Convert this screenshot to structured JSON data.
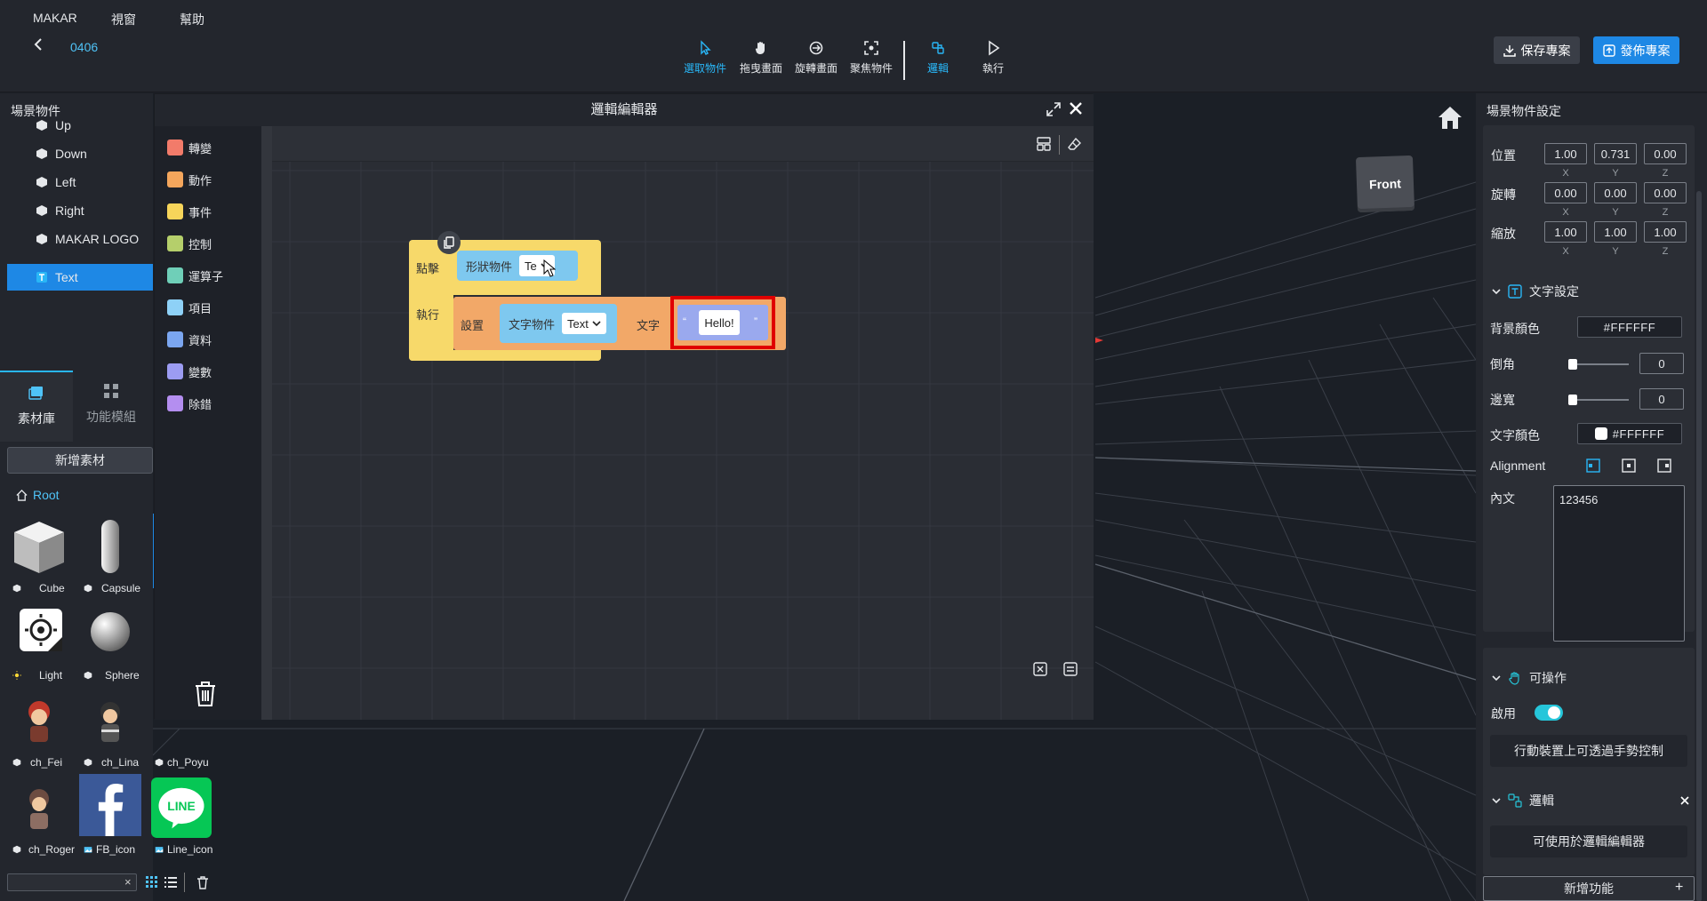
{
  "menu": {
    "app": "MAKAR",
    "view": "視窗",
    "help": "幫助"
  },
  "project": {
    "name": "0406"
  },
  "toolbar": {
    "select": "選取物件",
    "drag": "拖曳畫面",
    "rotate": "旋轉畫面",
    "focus": "聚焦物件",
    "logic": "邏輯",
    "run": "執行",
    "save": "保存專案",
    "publish": "發佈專案"
  },
  "scene": {
    "title": "場景物件",
    "items": [
      "Up",
      "Down",
      "Left",
      "Right",
      "MAKAR LOGO",
      "Text"
    ]
  },
  "left_tabs": {
    "assets": "素材庫",
    "modules": "功能模組"
  },
  "assets": {
    "add_label": "新增素材",
    "root": "Root",
    "items": [
      "Cube",
      "Capsule",
      "Light",
      "Sphere",
      "ch_Fei",
      "ch_Lina",
      "ch_Poyu",
      "ch_Roger",
      "FB_icon",
      "Line_icon"
    ]
  },
  "logic_editor": {
    "title": "邏輯編輯器",
    "categories": [
      {
        "label": "轉變",
        "color": "#f27b6a"
      },
      {
        "label": "動作",
        "color": "#f4a65c"
      },
      {
        "label": "事件",
        "color": "#f7d55a"
      },
      {
        "label": "控制",
        "color": "#b5cf6b"
      },
      {
        "label": "運算子",
        "color": "#6fcfb8"
      },
      {
        "label": "項目",
        "color": "#8ed1f7"
      },
      {
        "label": "資料",
        "color": "#7ba6f0"
      },
      {
        "label": "變數",
        "color": "#9c9cf2"
      },
      {
        "label": "除錯",
        "color": "#b48ef0"
      }
    ],
    "event_block": {
      "click": "點擊",
      "exec": "執行",
      "shape_label": "形狀物件",
      "shape_value": "Te"
    },
    "set_block": {
      "set": "設置",
      "textobj_label": "文字物件",
      "textobj_value": "Text",
      "prop_label": "文字",
      "string_value": "Hello!",
      "quote_open": "“",
      "quote_close": "”"
    }
  },
  "viewport": {
    "gizmo_label": "Front"
  },
  "inspector": {
    "title": "場景物件設定",
    "transform": {
      "position_label": "位置",
      "position": [
        "1.00",
        "0.731",
        "0.00"
      ],
      "rotation_label": "旋轉",
      "rotation": [
        "0.00",
        "0.00",
        "0.00"
      ],
      "scale_label": "縮放",
      "scale": [
        "1.00",
        "1.00",
        "1.00"
      ],
      "axes": [
        "X",
        "Y",
        "Z"
      ]
    },
    "text_settings": {
      "title": "文字設定",
      "bg_color_label": "背景顏色",
      "bg_color": "#FFFFFF",
      "corner_label": "倒角",
      "corner": "0",
      "border_label": "邊寬",
      "border": "0",
      "text_color_label": "文字顏色",
      "text_color": "#FFFFFF",
      "alignment_label": "Alignment",
      "content_label": "內文",
      "content": "123456"
    },
    "operable": {
      "title": "可操作",
      "enable_label": "啟用",
      "gesture_button": "行動裝置上可透過手勢控制"
    },
    "logic": {
      "title": "邏輯",
      "button": "可使用於邏輯編輯器"
    },
    "add_feature": "新增功能"
  }
}
